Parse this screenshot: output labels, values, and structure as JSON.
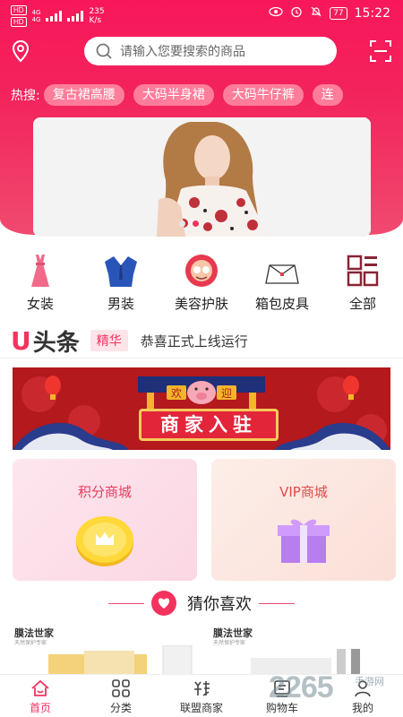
{
  "status": {
    "network_a": "4G",
    "network_b": "4G",
    "speed": "235",
    "speed_unit": "K/s",
    "battery": "77",
    "time": "15:22"
  },
  "search": {
    "placeholder": "请输入您要搜索的商品"
  },
  "hot": {
    "label": "热搜:",
    "items": [
      "复古裙高腰",
      "大码半身裙",
      "大码牛仔裤",
      "连"
    ]
  },
  "categories": [
    {
      "label": "女装",
      "icon": "dress-icon"
    },
    {
      "label": "男装",
      "icon": "suit-icon"
    },
    {
      "label": "美容护肤",
      "icon": "beauty-icon"
    },
    {
      "label": "箱包皮具",
      "icon": "bag-icon"
    },
    {
      "label": "全部",
      "icon": "grid-icon"
    }
  ],
  "headline": {
    "brand_u": "U",
    "brand_text": "头条",
    "tag": "精华",
    "message": "恭喜正式上线运行"
  },
  "merchant_banner": {
    "title": "商家入驻",
    "sign_left": "欢",
    "sign_right": "迎"
  },
  "cards": {
    "points": "积分商城",
    "vip": "VIP商城"
  },
  "guess": {
    "title": "猜你喜欢"
  },
  "products": [
    {
      "brand": "膜法世家",
      "sub": "天然保护专家"
    },
    {
      "brand": "膜法世家",
      "sub": "天然保护专家"
    }
  ],
  "tabs": [
    {
      "label": "首页",
      "icon": "home-icon",
      "active": true
    },
    {
      "label": "分类",
      "icon": "category-icon",
      "active": false
    },
    {
      "label": "联盟商家",
      "icon": "alliance-icon",
      "active": false
    },
    {
      "label": "购物车",
      "icon": "cart-icon",
      "active": false
    },
    {
      "label": "我的",
      "icon": "profile-icon",
      "active": false
    }
  ],
  "watermark": {
    "main": "2265",
    "sub": "手游网"
  },
  "colors": {
    "accent": "#f4325e",
    "header": "#f8185a"
  }
}
